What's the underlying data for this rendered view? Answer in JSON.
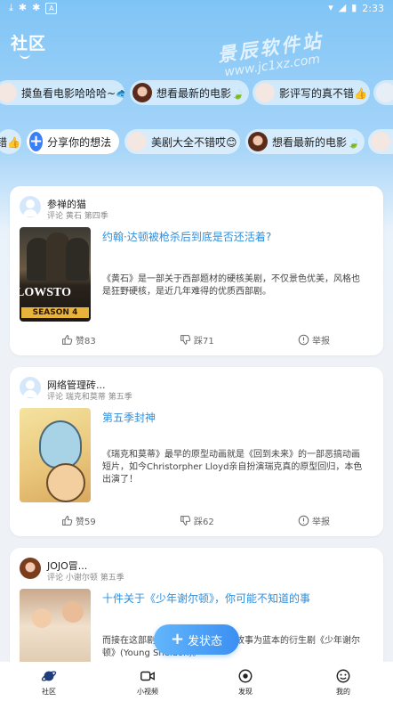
{
  "status_bar": {
    "time": "2:33"
  },
  "header": {
    "title": "社区"
  },
  "watermark": {
    "line1": "景辰软件站",
    "line2": "www.jc1xz.com"
  },
  "chip_row_1": [
    {
      "text": "摸鱼看电影哈哈哈~🐟",
      "avatar": "bunny-avatar"
    },
    {
      "text": "想看最新的电影🍃",
      "avatar": "girl-avatar"
    },
    {
      "text": "影评写的真不错👍",
      "avatar": "bunny-avatar"
    }
  ],
  "chip_row_2": [
    {
      "text": "错👍",
      "avatar": ""
    },
    {
      "text": "分享你的想法",
      "avatar": "plus"
    },
    {
      "text": "美剧大全不错哎😊",
      "avatar": "bunny-avatar"
    },
    {
      "text": "想看最新的电影🍃",
      "avatar": "girl-avatar"
    }
  ],
  "posts": [
    {
      "username": "参禅的猫",
      "subline": "评论 黄石 第四季",
      "title": "约翰·达顿被枪杀后到底是否还活着?",
      "body": "《黄石》是一部关于西部题材的硬核美剧，不仅景色优美，风格也是狂野硬核，是近几年难得的优质西部剧。",
      "poster_title": "LOWSTO",
      "poster_season": "SEASON 4",
      "likes": "赞83",
      "dislikes": "踩71",
      "report": "举报"
    },
    {
      "username": "网络管理砖...",
      "subline": "评论 瑞克和莫蒂 第五季",
      "title": "第五季封神",
      "body": "《瑞克和莫蒂》最早的原型动画就是《回到未来》的一部恶搞动画短片，如今Christorpher Lloyd亲自扮演瑞克真的原型回归，本色出演了！",
      "likes": "赞59",
      "dislikes": "踩62",
      "report": "举报"
    },
    {
      "username": "JOJO冒...",
      "subline": "评论 小谢尔顿 第五季",
      "title": "十件关于《少年谢尔顿》，你可能不知道的事",
      "body": "而接在这部剧……其主人公小时候故事为蓝本的衍生剧《少年谢尔顿》(Young Sheldon)。"
    }
  ],
  "fab": {
    "label": "发状态"
  },
  "bottom_nav": [
    {
      "label": "社区",
      "icon": "planet-icon"
    },
    {
      "label": "小视频",
      "icon": "video-icon"
    },
    {
      "label": "发现",
      "icon": "target-icon"
    },
    {
      "label": "我的",
      "icon": "smile-icon"
    }
  ],
  "colors": {
    "accent": "#3a7ff6",
    "title_link": "#2f8fdc",
    "bg_top": "#7fc4f6"
  }
}
